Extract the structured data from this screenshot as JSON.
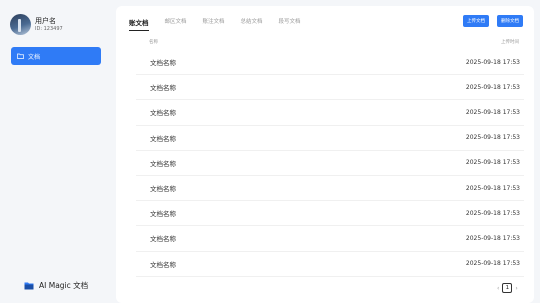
{
  "user": {
    "name": "用户名",
    "id": "ID: 123497"
  },
  "sidebar": {
    "items": [
      {
        "label": "文档"
      }
    ]
  },
  "brand": {
    "name": "AI Magic 文档"
  },
  "tabs": [
    {
      "label": "账文档"
    },
    {
      "label": "邮区文档"
    },
    {
      "label": "账注文档"
    },
    {
      "label": "总结文档"
    },
    {
      "label": "段写文档"
    }
  ],
  "toolbar": {
    "upload_label": "上传文档",
    "delete_label": "删除文档"
  },
  "table": {
    "columns": [
      "名称",
      "上传时间"
    ],
    "rows": [
      {
        "name": "文档名称",
        "time": "2025-09-18  17:53"
      },
      {
        "name": "文档名称",
        "time": "2025-09-18  17:53"
      },
      {
        "name": "文档名称",
        "time": "2025-09-18  17:53"
      },
      {
        "name": "文档名称",
        "time": "2025-09-18  17:53"
      },
      {
        "name": "文档名称",
        "time": "2025-09-18  17:53"
      },
      {
        "name": "文档名称",
        "time": "2025-09-18  17:53"
      },
      {
        "name": "文档名称",
        "time": "2025-09-18  17:53"
      },
      {
        "name": "文档名称",
        "time": "2025-09-18  17:53"
      },
      {
        "name": "文档名称",
        "time": "2025-09-18  17:53"
      }
    ]
  },
  "pagination": {
    "prev": "‹",
    "current": "1",
    "next": "›"
  },
  "colors": {
    "accent": "#2f7bf6",
    "background": "#f4f6f9"
  }
}
